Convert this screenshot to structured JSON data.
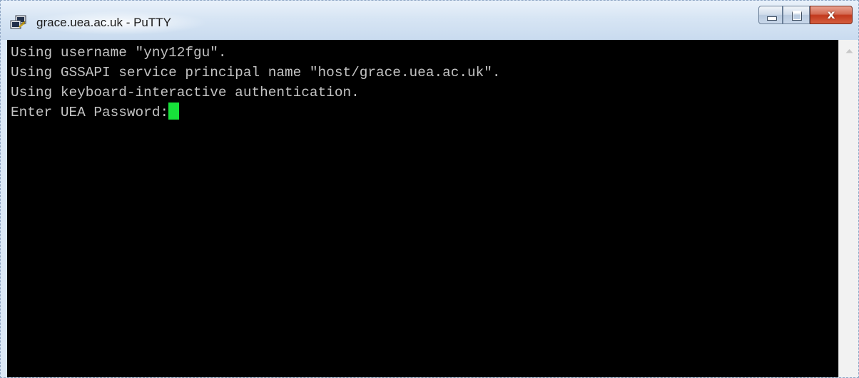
{
  "window": {
    "title": "grace.uea.ac.uk - PuTTY",
    "app_icon": "putty-icon",
    "caption_icons": [
      "minimize-icon",
      "maximize-icon",
      "close-icon"
    ],
    "close_glyph": "x"
  },
  "terminal": {
    "lines": [
      "Using username \"yny12fgu\".",
      "Using GSSAPI service principal name \"host/grace.uea.ac.uk\".",
      "Using keyboard-interactive authentication.",
      "Enter UEA Password:"
    ],
    "cursor_color": "#17e03a",
    "text_color": "#c3c3c3",
    "background_color": "#000000"
  },
  "scrollbar": {
    "up_icon": "scroll-up-arrow-icon"
  }
}
